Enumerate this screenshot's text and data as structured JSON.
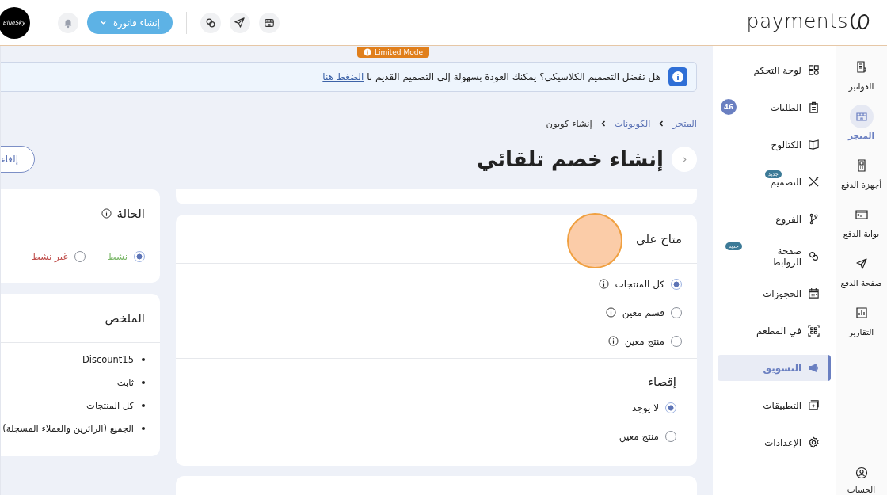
{
  "topbar": {
    "logo": "payments",
    "avatar": "BlueSky",
    "create_button": "إنشاء فاتورة"
  },
  "limited_badge": "Limited Mode",
  "banner": {
    "text": "هل تفضل التصميم الكلاسيكي؟ يمكنك العودة بسهولة إلى التصميم القديم با",
    "link": "الضغط هنا"
  },
  "breadcrumb": [
    {
      "label": "المتجر",
      "current": false
    },
    {
      "label": "الكوبونات",
      "current": false
    },
    {
      "label": "إنشاء كوبون",
      "current": true
    }
  ],
  "title": "إنشاء خصم تلقائي",
  "cancel_button": "إلغاء",
  "availability": {
    "title": "متاح على",
    "options": [
      {
        "label": "كل المنتجات",
        "selected": true,
        "info": true
      },
      {
        "label": "قسم معين",
        "selected": false,
        "info": true
      },
      {
        "label": "منتج معين",
        "selected": false,
        "info": true
      }
    ]
  },
  "exclusion": {
    "title": "إقصاء",
    "options": [
      {
        "label": "لا يوجد",
        "selected": true
      },
      {
        "label": "منتج معين",
        "selected": false
      }
    ]
  },
  "status": {
    "title": "الحالة",
    "options": [
      {
        "label": "نشط",
        "selected": true,
        "color": "#7cb86a"
      },
      {
        "label": "غير نشط",
        "selected": false,
        "color": "#c0504d"
      }
    ]
  },
  "summary": {
    "title": "الملخص",
    "items": [
      "Discount15",
      "ثابت",
      "كل المنتجات",
      "الجميع (الزائرين والعملاء المسجلة)"
    ]
  },
  "rail": [
    {
      "label": "الفواتير",
      "selected": false
    },
    {
      "label": "المتجر",
      "selected": true
    },
    {
      "label": "أجهزة الدفع",
      "selected": false
    },
    {
      "label": "بوابة الدفع",
      "selected": false
    },
    {
      "label": "صفحة الدفع",
      "selected": false
    },
    {
      "label": "التقارير",
      "selected": false
    }
  ],
  "rail_bottom": {
    "label": "الحساب",
    "selected": false
  },
  "menu": [
    {
      "label": "لوحة التحكم",
      "selected": false
    },
    {
      "label": "الطلبات",
      "selected": false,
      "count": "46"
    },
    {
      "label": "الكتالوج",
      "selected": false
    },
    {
      "label": "التصميم",
      "selected": false,
      "badge": "جديد"
    },
    {
      "label": "الفروع",
      "selected": false
    },
    {
      "label": "صفحة الروابط",
      "selected": false,
      "badge": "جديد"
    },
    {
      "label": "الحجوزات",
      "selected": false
    },
    {
      "label": "في المطعم",
      "selected": false
    },
    {
      "label": "التسويق",
      "selected": true
    },
    {
      "label": "التطبيقات",
      "selected": false
    },
    {
      "label": "الإعدادات",
      "selected": false
    }
  ]
}
